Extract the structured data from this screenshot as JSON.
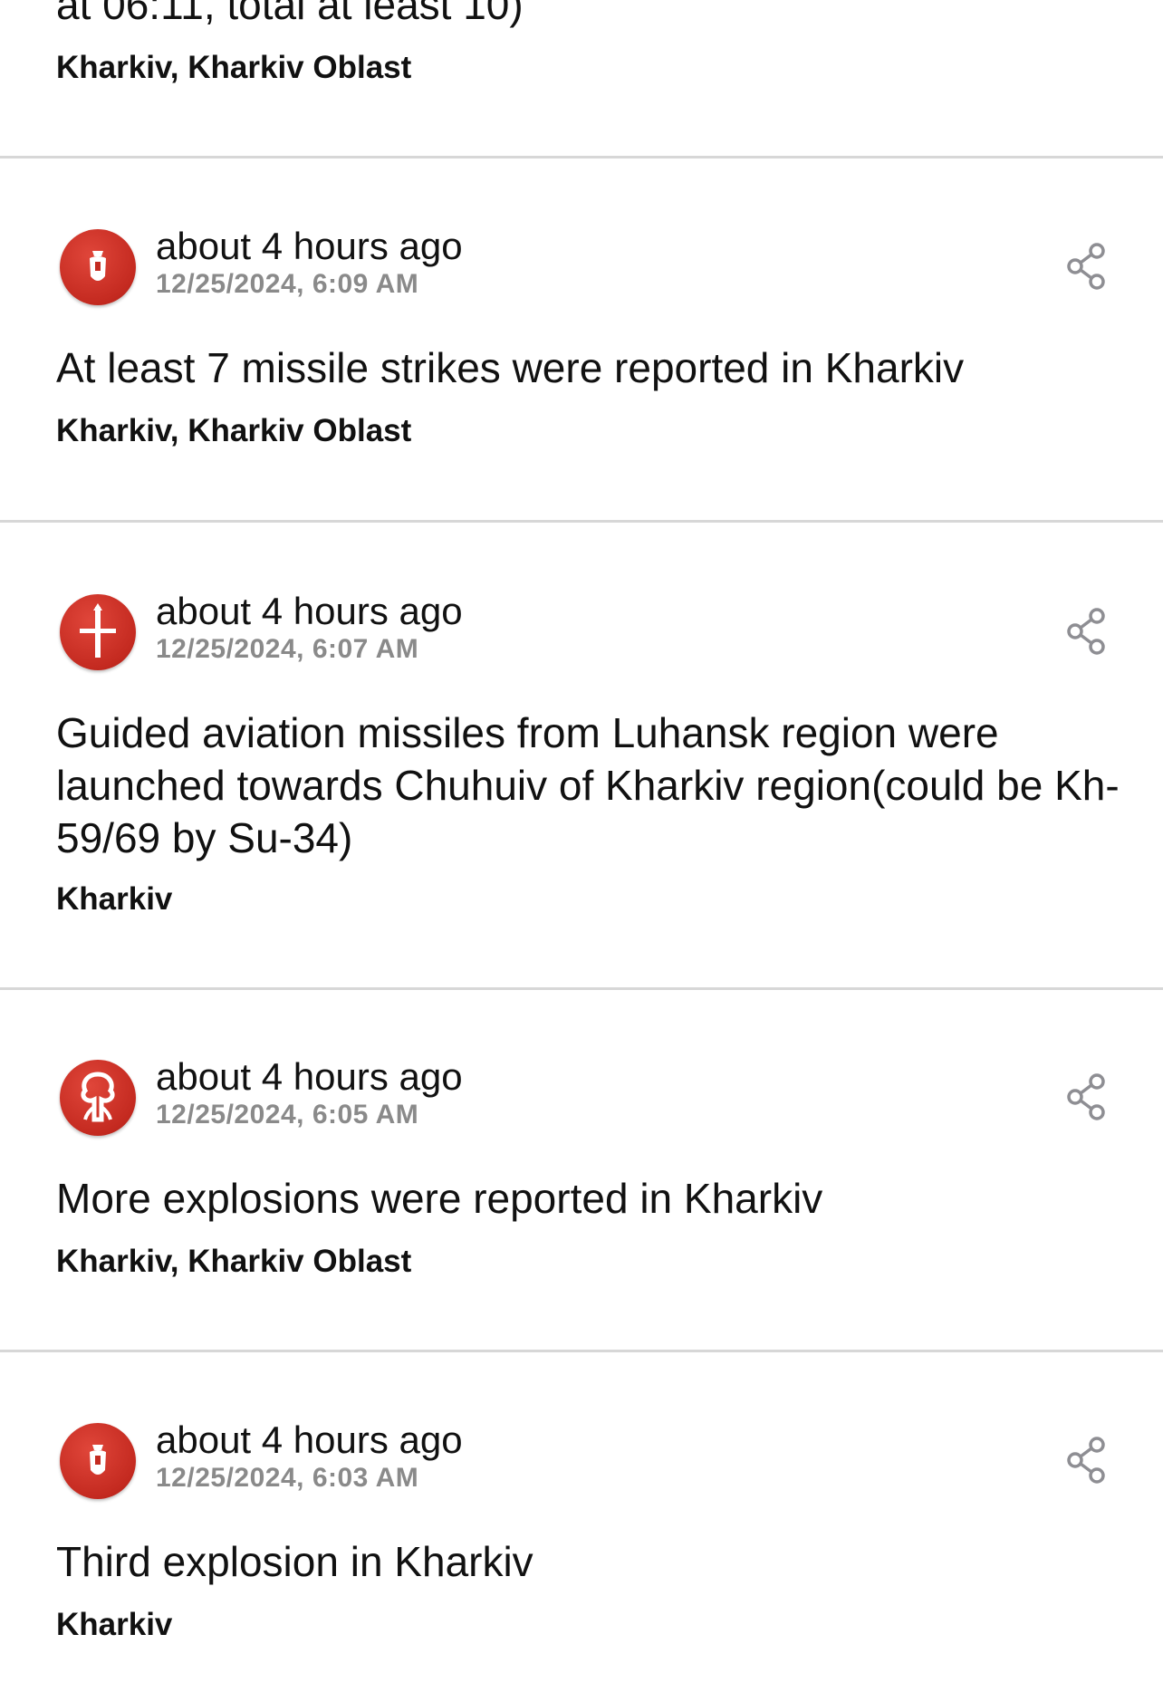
{
  "top_partial": {
    "message_tail": "at 06:11, total at least 10)",
    "location": "Kharkiv, Kharkiv Oblast"
  },
  "items": [
    {
      "icon": "bomb-icon",
      "relative_time": "about 4 hours ago",
      "timestamp": "12/25/2024, 6:09 AM",
      "message": "At least 7 missile strikes were reported in Kharkiv",
      "location": "Kharkiv, Kharkiv Oblast"
    },
    {
      "icon": "missile-icon",
      "relative_time": "about 4 hours ago",
      "timestamp": "12/25/2024, 6:07 AM",
      "message": "Guided aviation missiles from Luhansk region were launched towards Chuhuiv of Kharkiv region(could be Kh-59/69 by Su-34)",
      "location": "Kharkiv"
    },
    {
      "icon": "explosion-icon",
      "relative_time": "about 4 hours ago",
      "timestamp": "12/25/2024, 6:05 AM",
      "message": "More explosions were reported in Kharkiv",
      "location": "Kharkiv, Kharkiv Oblast"
    },
    {
      "icon": "bomb-icon",
      "relative_time": "about 4 hours ago",
      "timestamp": "12/25/2024, 6:03 AM",
      "message": "Third explosion in Kharkiv",
      "location": "Kharkiv"
    }
  ],
  "colors": {
    "icon_red": "#c42a20",
    "separator": "#d7d7d7",
    "timestamp_gray": "#8a8a8a",
    "share_gray": "#8e8e93"
  }
}
